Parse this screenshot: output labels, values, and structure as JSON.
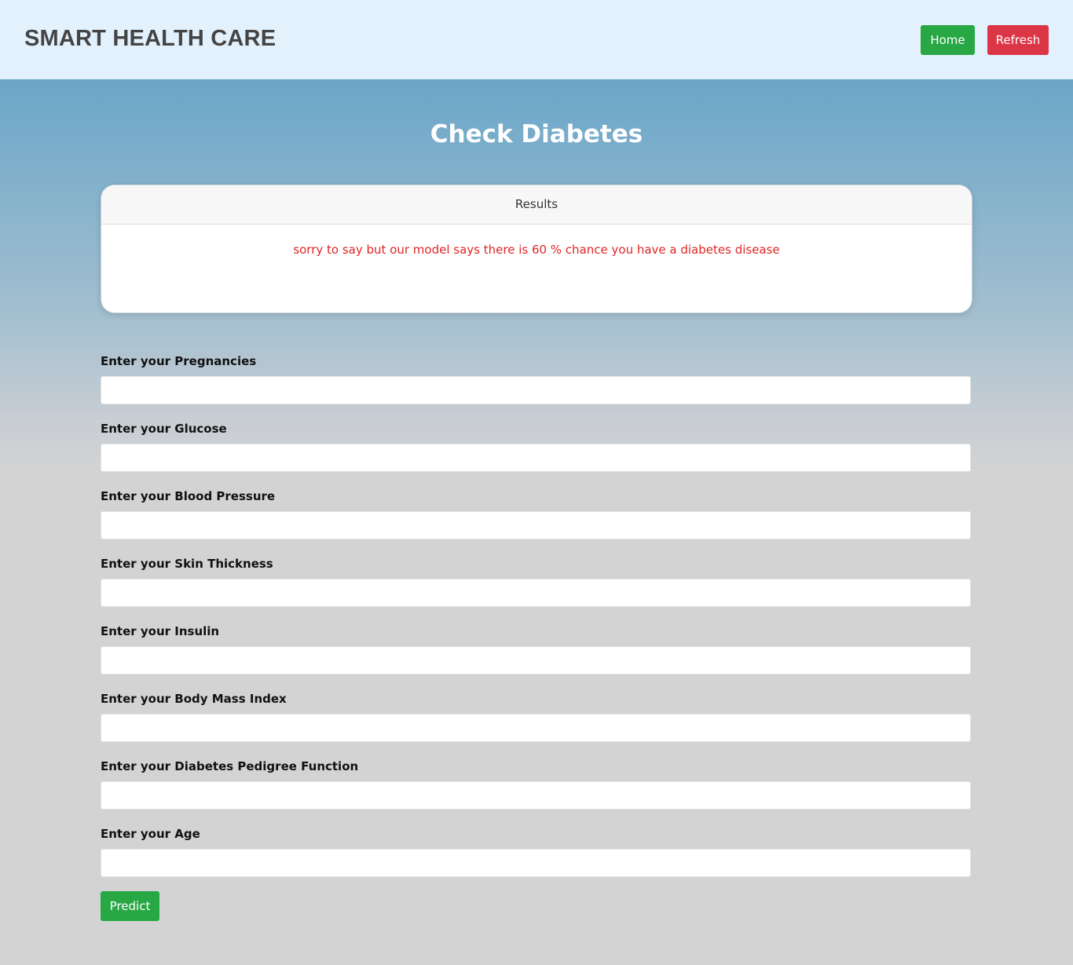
{
  "navbar": {
    "brand": "SMART HEALTH CARE",
    "home_label": "Home",
    "refresh_label": "Refresh"
  },
  "page": {
    "title": "Check Diabetes"
  },
  "results": {
    "header": "Results",
    "message": "sorry to say but our model says there is 60 % chance you have a diabetes disease"
  },
  "form": {
    "fields": [
      {
        "label": "Enter your Pregnancies",
        "value": ""
      },
      {
        "label": "Enter your Glucose",
        "value": ""
      },
      {
        "label": "Enter your Blood Pressure",
        "value": ""
      },
      {
        "label": "Enter your Skin Thickness",
        "value": ""
      },
      {
        "label": "Enter your Insulin",
        "value": ""
      },
      {
        "label": "Enter your Body Mass Index",
        "value": ""
      },
      {
        "label": "Enter your Diabetes Pedigree Function",
        "value": ""
      },
      {
        "label": "Enter your Age",
        "value": ""
      }
    ],
    "submit_label": "Predict"
  },
  "colors": {
    "navbar_bg": "#e3f1fc",
    "success": "#28a745",
    "danger": "#dc3545",
    "result_text": "#e02424",
    "page_bg": "#d3d3d3"
  }
}
